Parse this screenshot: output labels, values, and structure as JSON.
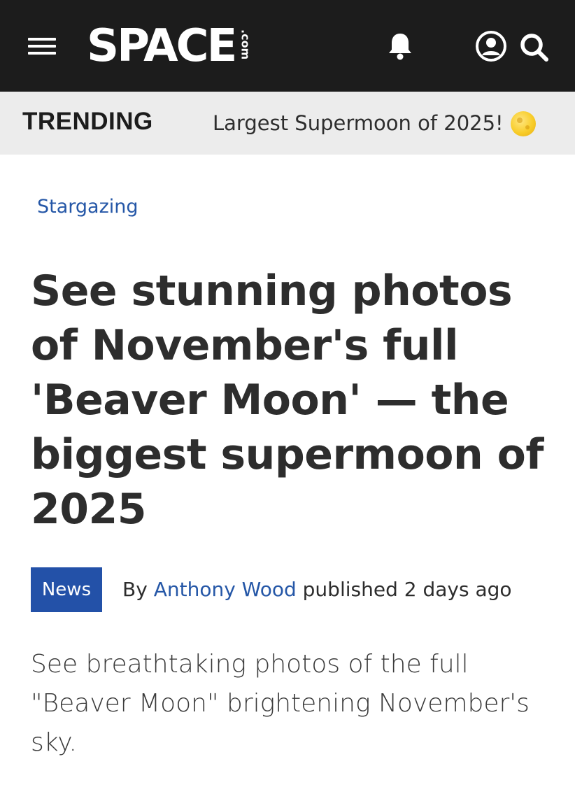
{
  "header": {
    "logo_text": "SPACE",
    "logo_suffix": ".com",
    "background_color": "#1c1c1c",
    "icons": [
      "menu-icon",
      "bell-icon",
      "account-icon",
      "search-icon"
    ]
  },
  "trending": {
    "label": "TRENDING",
    "link_text": "Largest Supermoon of 2025!",
    "emoji_icon": "full-moon-icon"
  },
  "article": {
    "category": "Stargazing",
    "headline": "See stunning photos of November's full 'Beaver Moon' — the biggest supermoon of 2025",
    "badge": "News",
    "byline_prefix": "By",
    "author": "Anthony Wood",
    "published": "published 2 days ago",
    "standfirst": "See breathtaking photos of the full \"Beaver Moon\" brightening November's sky.",
    "link_color": "#2557a7",
    "badge_color": "#2351a8"
  }
}
